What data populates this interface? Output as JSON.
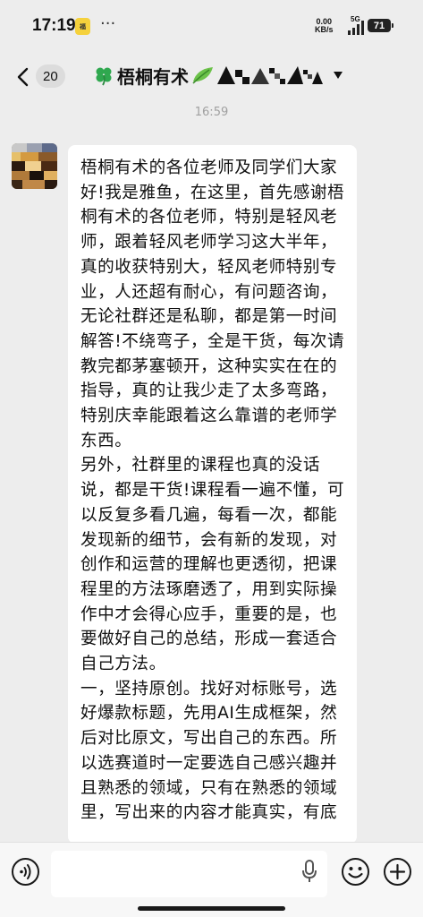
{
  "status_bar": {
    "time": "17:19",
    "notification_badge": "福",
    "more_indicator": "···",
    "net_speed_value": "0.00",
    "net_speed_unit": "KB/s",
    "network_type": "5G",
    "battery": "71"
  },
  "header": {
    "unread_count": "20",
    "title": "梧桐有术",
    "clover_color": "#2fa84f",
    "leaf_color": "#5ab83c"
  },
  "chat": {
    "timestamp": "16:59",
    "message": {
      "paragraphs": [
        "梧桐有术的各位老师及同学们大家好!我是雅鱼，在这里，首先感谢梧桐有术的各位老师，特别是轻风老师，跟着轻风老师学习这大半年，真的收获特别大，轻风老师特别专业，人还超有耐心，有问题咨询，无论社群还是私聊，都是第一时间解答!不绕弯子，全是干货，每次请教完都茅塞顿开，这种实实在在的指导，真的让我少走了太多弯路，特别庆幸能跟着这么靠谱的老师学东西。",
        "另外，社群里的课程也真的没话说，都是干货!课程看一遍不懂，可以反复多看几遍，每看一次，都能发现新的细节，会有新的发现，对创作和运营的理解也更透彻，把课程里的方法琢磨透了，用到实际操作中才会得心应手，重要的是，也要做好自己的总结，形成一套适合自己方法。",
        "一，坚持原创。找好对标账号，选好爆款标题，先用AI生成框架，然后对比原文，写出自己的东西。所以选赛道时一定要选自己感兴趣并且熟悉的领域，只有在熟悉的领域里，写出来的内容才能真实，有底"
      ]
    }
  },
  "input_bar": {
    "voice_icon": "voice-icon",
    "mic_icon": "microphone-icon",
    "emoji_icon": "emoji-icon",
    "plus_icon": "plus-icon"
  }
}
